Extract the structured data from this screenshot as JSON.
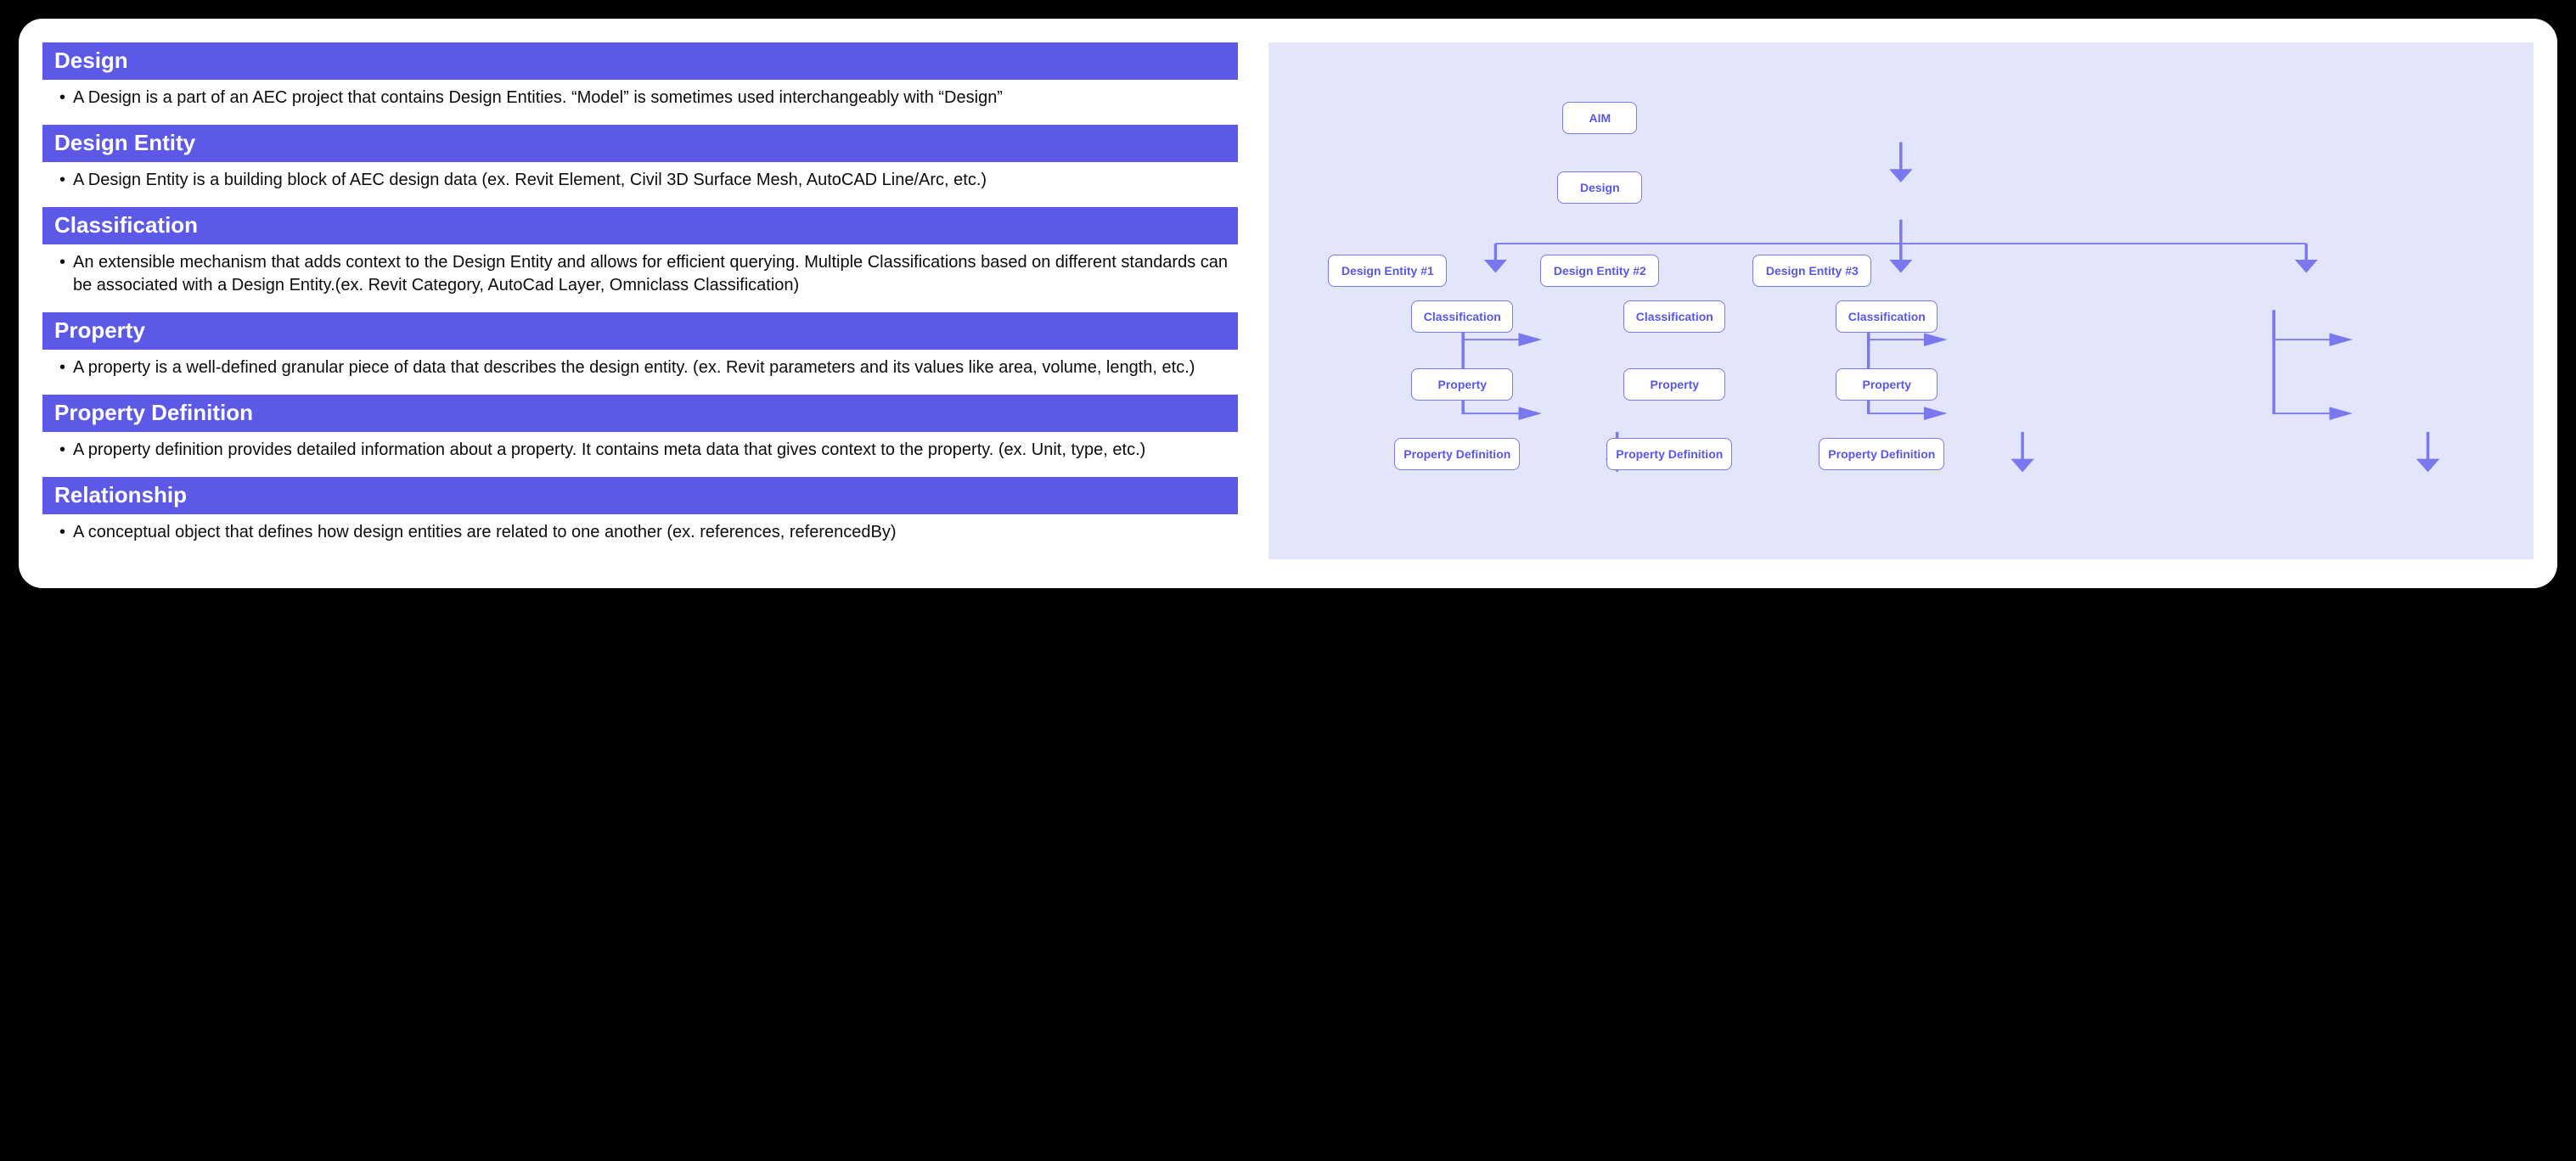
{
  "definitions": [
    {
      "title": "Design",
      "body": "A Design is a part of an AEC project that contains Design Entities. “Model” is sometimes used interchangeably with “Design”"
    },
    {
      "title": "Design Entity",
      "body": "A Design Entity is a building block of AEC design data (ex. Revit Element, Civil 3D Surface Mesh, AutoCAD Line/Arc, etc.)"
    },
    {
      "title": "Classification",
      "body": "An extensible mechanism that adds context to the Design Entity and allows for efficient querying. Multiple Classifications based on different standards can be associated with a Design Entity.(ex. Revit Category, AutoCad Layer, Omniclass Classification)"
    },
    {
      "title": "Property",
      "body": "A property is a well-defined granular piece of data that describes the design entity. (ex. Revit parameters and its values like area, volume, length, etc.)"
    },
    {
      "title": "Property Definition",
      "body": "A property definition provides detailed information about a property. It contains meta data that gives context to the property. (ex. Unit, type, etc.)"
    },
    {
      "title": "Relationship",
      "body": "A conceptual object that defines how design entities are related to one another (ex. references, referencedBy)"
    }
  ],
  "diagram": {
    "aim": "AIM",
    "design": "Design",
    "entities": [
      {
        "entity": "Design Entity #1",
        "classification": "Classification",
        "property": "Property",
        "propdef": "Property Definition"
      },
      {
        "entity": "Design Entity #2",
        "classification": "Classification",
        "property": "Property",
        "propdef": "Property Definition"
      },
      {
        "entity": "Design Entity #3",
        "classification": "Classification",
        "property": "Property",
        "propdef": "Property Definition"
      }
    ]
  },
  "colors": {
    "accent": "#5c59e8",
    "diagram_bg": "#e3e5fb",
    "node_border": "#7a78ef"
  }
}
